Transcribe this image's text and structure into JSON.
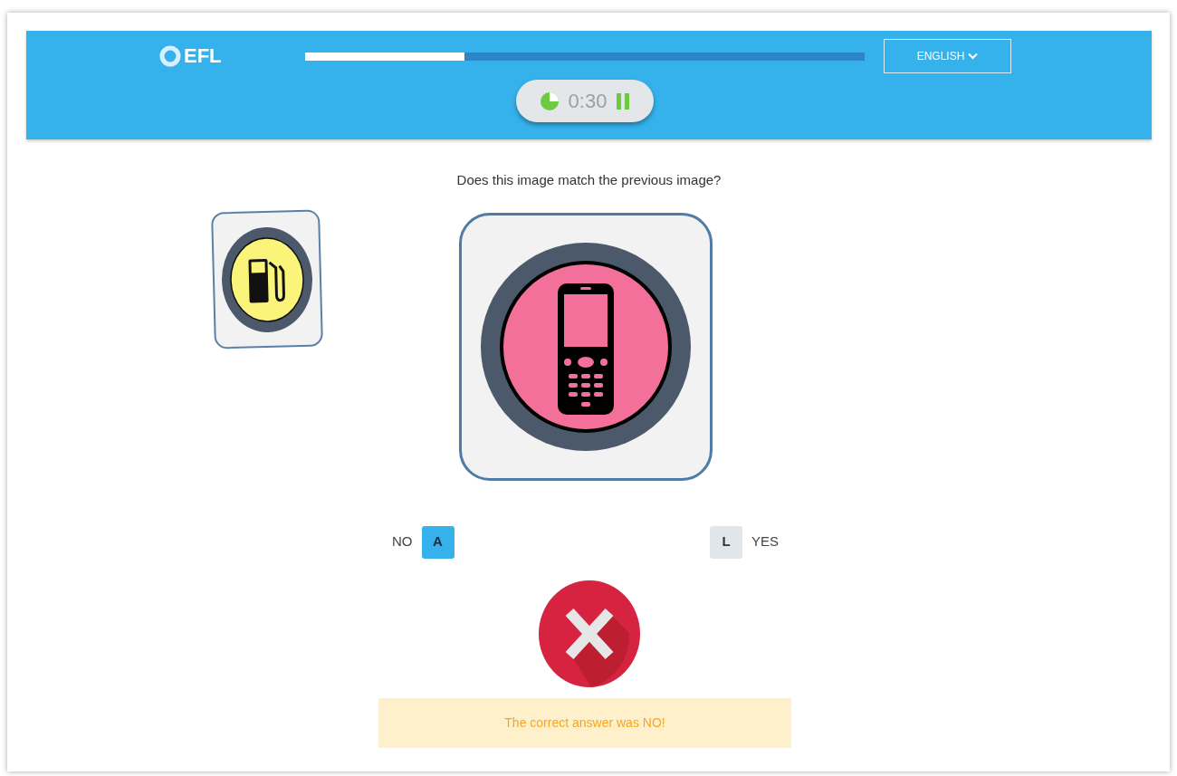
{
  "header": {
    "logo": "EFL",
    "progress": {
      "level": 0.285
    },
    "language": {
      "label": "ENGLISH"
    },
    "timer": {
      "time": "0:30",
      "paused": false
    }
  },
  "question": "Does this image match the previous image?",
  "answers": [
    {
      "label": "NO",
      "key": "A",
      "selected": true
    },
    {
      "label": "YES",
      "key": "L",
      "selected": false
    }
  ],
  "result": {
    "kind": "incorrect",
    "message": "The correct answer was NO!"
  }
}
